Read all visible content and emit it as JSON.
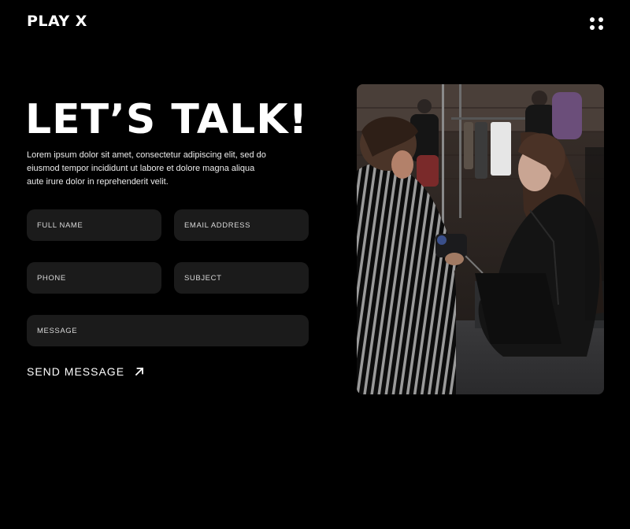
{
  "header": {
    "logo": "PLAY X",
    "menu_icon": "dots-grid-icon"
  },
  "hero": {
    "title": "LET’S TALK!",
    "intro": "Lorem ipsum dolor sit amet, consectetur adipiscing elit, sed do eiusmod tempor incididunt ut labore et dolore magna aliqua aute irure dolor in reprehenderit velit."
  },
  "form": {
    "full_name": "FULL NAME",
    "email": "EMAIL ADDRESS",
    "phone": "PHONE",
    "subject": "SUBJECT",
    "message": "MESSAGE",
    "send_label": "SEND MESSAGE",
    "send_icon": "arrow-up-right-icon"
  },
  "colors": {
    "background": "#000000",
    "field_background": "#1b1b1b",
    "text": "#ffffff"
  }
}
